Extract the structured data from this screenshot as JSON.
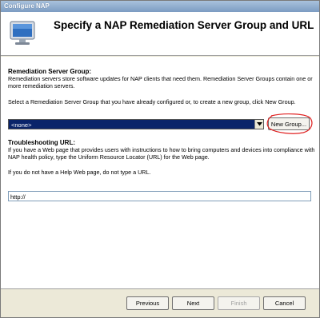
{
  "window": {
    "title": "Configure NAP"
  },
  "header": {
    "title": "Specify a NAP Remediation Server Group and URL",
    "icon": "computer-monitor-icon"
  },
  "remediation": {
    "heading": "Remediation Server Group:",
    "description": "Remediation servers store software updates for NAP clients that need them. Remediation Server Groups contain one or more remediation servers.",
    "instruction": "Select a Remediation Server Group that you have already configured or, to create a new group, click New Group.",
    "selected_group": "<none>",
    "new_group_label": "New Group..."
  },
  "troubleshooting": {
    "heading": "Troubleshooting URL:",
    "description": "If you have a Web page that provides users with instructions to how to bring computers and devices into compliance with NAP health policy, type the Uniform Resource Locator (URL) for the Web page.",
    "note": "If you do not have a Help Web page, do not type a URL.",
    "url_value": "http://"
  },
  "footer": {
    "previous_label": "Previous",
    "next_label": "Next",
    "finish_label": "Finish",
    "cancel_label": "Cancel"
  },
  "colors": {
    "selection": "#0a246a",
    "annotation": "#e02020"
  }
}
